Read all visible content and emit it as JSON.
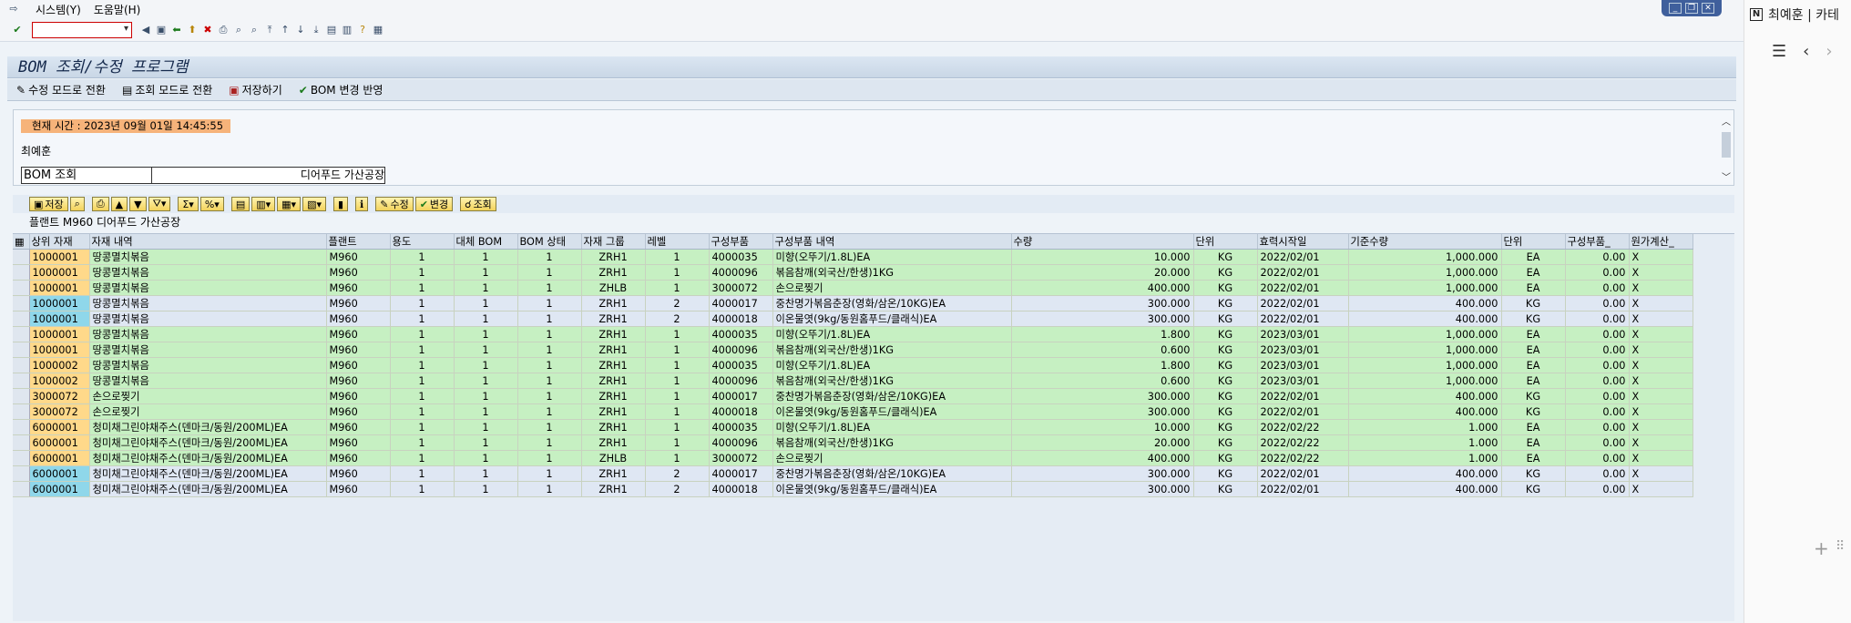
{
  "menu": {
    "system": "시스템(Y)",
    "help": "도움말(H)"
  },
  "title": "BOM 조회/수정 프로그램",
  "app_toolbar": {
    "edit_mode": "수정 모드로 전환",
    "view_mode": "조회 모드로 전환",
    "save": "저장하기",
    "apply_bom": "BOM 변경 반영"
  },
  "header": {
    "current_time": "현재 시간 : 2023년 09월 01일 14:45:55",
    "user": "최예훈",
    "bom_label": "BOM 조회",
    "bom_plant": "디어푸드 가산공장"
  },
  "alv_toolbar": {
    "save": "저장",
    "edit": "수정",
    "change": "변경",
    "query": "조회"
  },
  "grid_caption": "플랜트 M960 디어푸드 가산공장",
  "columns": [
    "상위 자재",
    "자재 내역",
    "플랜트",
    "용도",
    "대체 BOM",
    "BOM 상태",
    "자재 그룹",
    "레벨",
    "구성부품",
    "구성부품 내역",
    "수량",
    "단위",
    "효력시작일",
    "기준수량",
    "단위",
    "구성부품_",
    "원가계산_"
  ],
  "rows": [
    {
      "c": "g",
      "v": [
        "1000001",
        "땅콩멸치볶음",
        "M960",
        "1",
        "1",
        "1",
        "ZRH1",
        "1",
        "4000035",
        "미향(오뚜기/1.8L)EA",
        "10.000",
        "KG",
        "2022/02/01",
        "1,000.000",
        "EA",
        "0.00",
        "X"
      ]
    },
    {
      "c": "g",
      "v": [
        "1000001",
        "땅콩멸치볶음",
        "M960",
        "1",
        "1",
        "1",
        "ZRH1",
        "1",
        "4000096",
        "볶음참깨(외국산/한생)1KG",
        "20.000",
        "KG",
        "2022/02/01",
        "1,000.000",
        "EA",
        "0.00",
        "X"
      ]
    },
    {
      "c": "g",
      "v": [
        "1000001",
        "땅콩멸치볶음",
        "M960",
        "1",
        "1",
        "1",
        "ZHLB",
        "1",
        "3000072",
        "손으로찢기",
        "400.000",
        "KG",
        "2022/02/01",
        "1,000.000",
        "EA",
        "0.00",
        "X"
      ]
    },
    {
      "c": "b",
      "v": [
        "1000001",
        "땅콩멸치볶음",
        "M960",
        "1",
        "1",
        "1",
        "ZRH1",
        "2",
        "4000017",
        "중찬명가볶음춘장(영화/삼온/10KG)EA",
        "300.000",
        "KG",
        "2022/02/01",
        "400.000",
        "KG",
        "0.00",
        "X"
      ]
    },
    {
      "c": "b",
      "v": [
        "1000001",
        "땅콩멸치볶음",
        "M960",
        "1",
        "1",
        "1",
        "ZRH1",
        "2",
        "4000018",
        "이온물엿(9kg/동원홈푸드/클래식)EA",
        "300.000",
        "KG",
        "2022/02/01",
        "400.000",
        "KG",
        "0.00",
        "X"
      ]
    },
    {
      "c": "g",
      "v": [
        "1000001",
        "땅콩멸치볶음",
        "M960",
        "1",
        "1",
        "1",
        "ZRH1",
        "1",
        "4000035",
        "미향(오뚜기/1.8L)EA",
        "1.800",
        "KG",
        "2023/03/01",
        "1,000.000",
        "EA",
        "0.00",
        "X"
      ]
    },
    {
      "c": "g",
      "v": [
        "1000001",
        "땅콩멸치볶음",
        "M960",
        "1",
        "1",
        "1",
        "ZRH1",
        "1",
        "4000096",
        "볶음참깨(외국산/한생)1KG",
        "0.600",
        "KG",
        "2023/03/01",
        "1,000.000",
        "EA",
        "0.00",
        "X"
      ]
    },
    {
      "c": "g",
      "v": [
        "1000002",
        "땅콩멸치볶음",
        "M960",
        "1",
        "1",
        "1",
        "ZRH1",
        "1",
        "4000035",
        "미향(오뚜기/1.8L)EA",
        "1.800",
        "KG",
        "2023/03/01",
        "1,000.000",
        "EA",
        "0.00",
        "X"
      ]
    },
    {
      "c": "g",
      "v": [
        "1000002",
        "땅콩멸치볶음",
        "M960",
        "1",
        "1",
        "1",
        "ZRH1",
        "1",
        "4000096",
        "볶음참깨(외국산/한생)1KG",
        "0.600",
        "KG",
        "2023/03/01",
        "1,000.000",
        "EA",
        "0.00",
        "X"
      ]
    },
    {
      "c": "g",
      "v": [
        "3000072",
        "손으로찢기",
        "M960",
        "1",
        "1",
        "1",
        "ZRH1",
        "1",
        "4000017",
        "중찬명가볶음춘장(영화/삼온/10KG)EA",
        "300.000",
        "KG",
        "2022/02/01",
        "400.000",
        "KG",
        "0.00",
        "X"
      ]
    },
    {
      "c": "g",
      "v": [
        "3000072",
        "손으로찢기",
        "M960",
        "1",
        "1",
        "1",
        "ZRH1",
        "1",
        "4000018",
        "이온물엿(9kg/동원홈푸드/클래식)EA",
        "300.000",
        "KG",
        "2022/02/01",
        "400.000",
        "KG",
        "0.00",
        "X"
      ]
    },
    {
      "c": "g",
      "v": [
        "6000001",
        "청미채그린야채주스(덴마크/동원/200ML)EA",
        "M960",
        "1",
        "1",
        "1",
        "ZRH1",
        "1",
        "4000035",
        "미향(오뚜기/1.8L)EA",
        "10.000",
        "KG",
        "2022/02/22",
        "1.000",
        "EA",
        "0.00",
        "X"
      ]
    },
    {
      "c": "g",
      "v": [
        "6000001",
        "청미채그린야채주스(덴마크/동원/200ML)EA",
        "M960",
        "1",
        "1",
        "1",
        "ZRH1",
        "1",
        "4000096",
        "볶음참깨(외국산/한생)1KG",
        "20.000",
        "KG",
        "2022/02/22",
        "1.000",
        "EA",
        "0.00",
        "X"
      ]
    },
    {
      "c": "g",
      "v": [
        "6000001",
        "청미채그린야채주스(덴마크/동원/200ML)EA",
        "M960",
        "1",
        "1",
        "1",
        "ZHLB",
        "1",
        "3000072",
        "손으로찢기",
        "400.000",
        "KG",
        "2022/02/22",
        "1.000",
        "EA",
        "0.00",
        "X"
      ]
    },
    {
      "c": "b",
      "v": [
        "6000001",
        "청미채그린야채주스(덴마크/동원/200ML)EA",
        "M960",
        "1",
        "1",
        "1",
        "ZRH1",
        "2",
        "4000017",
        "중찬명가볶음춘장(영화/삼온/10KG)EA",
        "300.000",
        "KG",
        "2022/02/01",
        "400.000",
        "KG",
        "0.00",
        "X"
      ]
    },
    {
      "c": "b",
      "v": [
        "6000001",
        "청미채그린야채주스(덴마크/동원/200ML)EA",
        "M960",
        "1",
        "1",
        "1",
        "ZRH1",
        "2",
        "4000018",
        "이온물엿(9kg/동원홈푸드/클래식)EA",
        "300.000",
        "KG",
        "2022/02/01",
        "400.000",
        "KG",
        "0.00",
        "X"
      ]
    }
  ],
  "right_panel": {
    "title": "최예훈 | 카테"
  }
}
